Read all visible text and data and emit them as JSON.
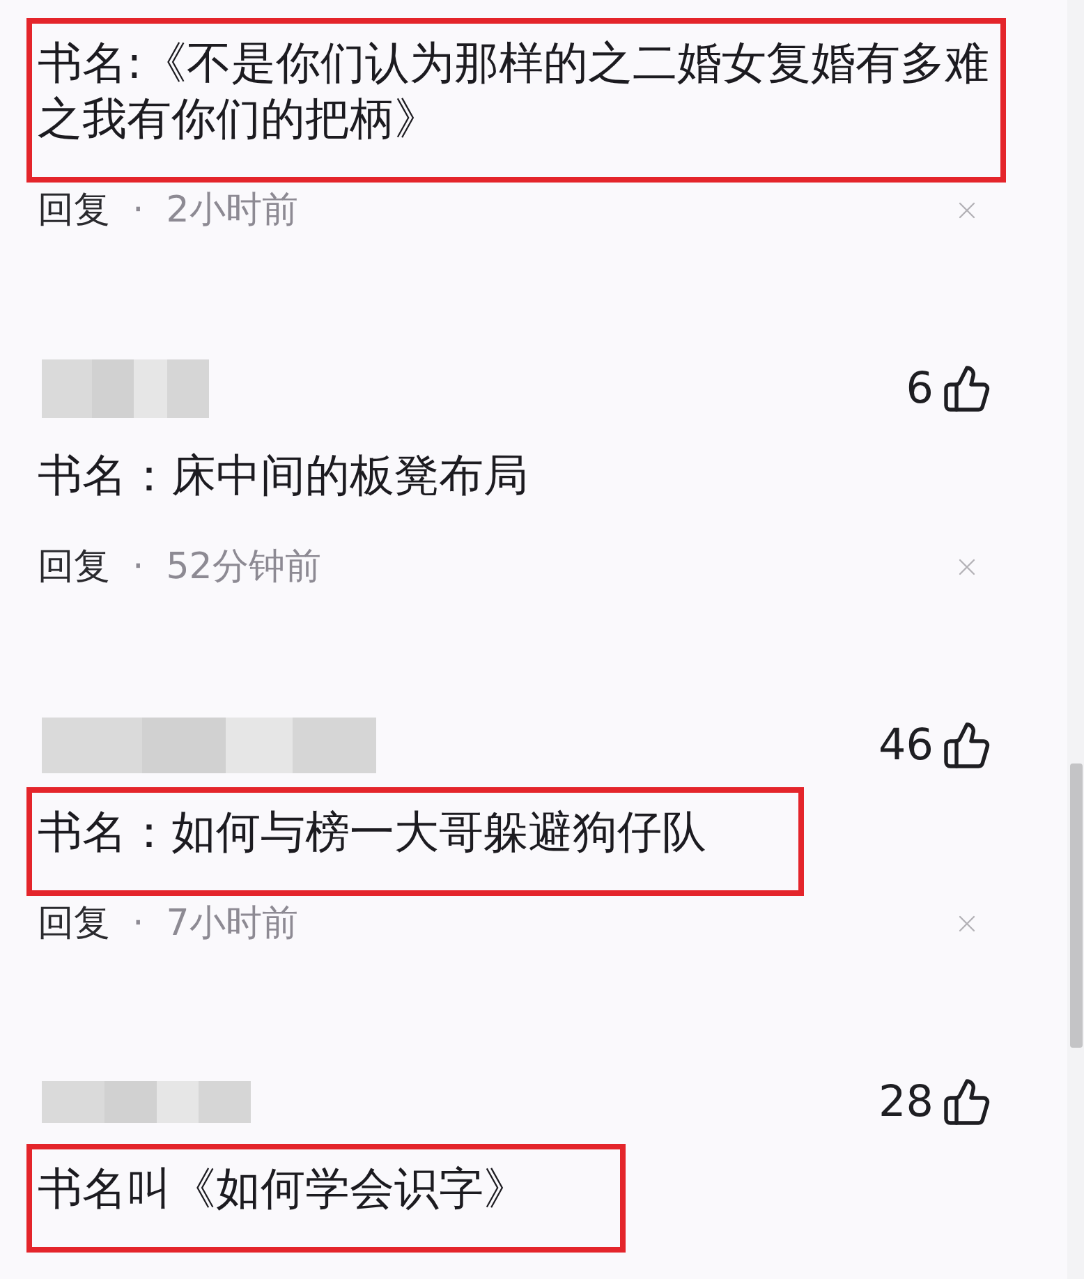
{
  "comments": [
    {
      "text": "书名:《不是你们认为那样的之二婚女复婚有多难之我有你们的把柄》",
      "highlighted": true,
      "reply": {
        "label": "回复",
        "separator": "·",
        "time": "2小时前"
      }
    },
    {
      "likes": "6",
      "text": "书名：床中间的板凳布局",
      "highlighted": false,
      "reply": {
        "label": "回复",
        "separator": "·",
        "time": "52分钟前"
      }
    },
    {
      "likes": "46",
      "text": "书名：如何与榜一大哥躲避狗仔队",
      "highlighted": true,
      "reply": {
        "label": "回复",
        "separator": "·",
        "time": "7小时前"
      }
    },
    {
      "likes": "28",
      "text": "书名叫《如何学会识字》",
      "highlighted": true
    }
  ]
}
